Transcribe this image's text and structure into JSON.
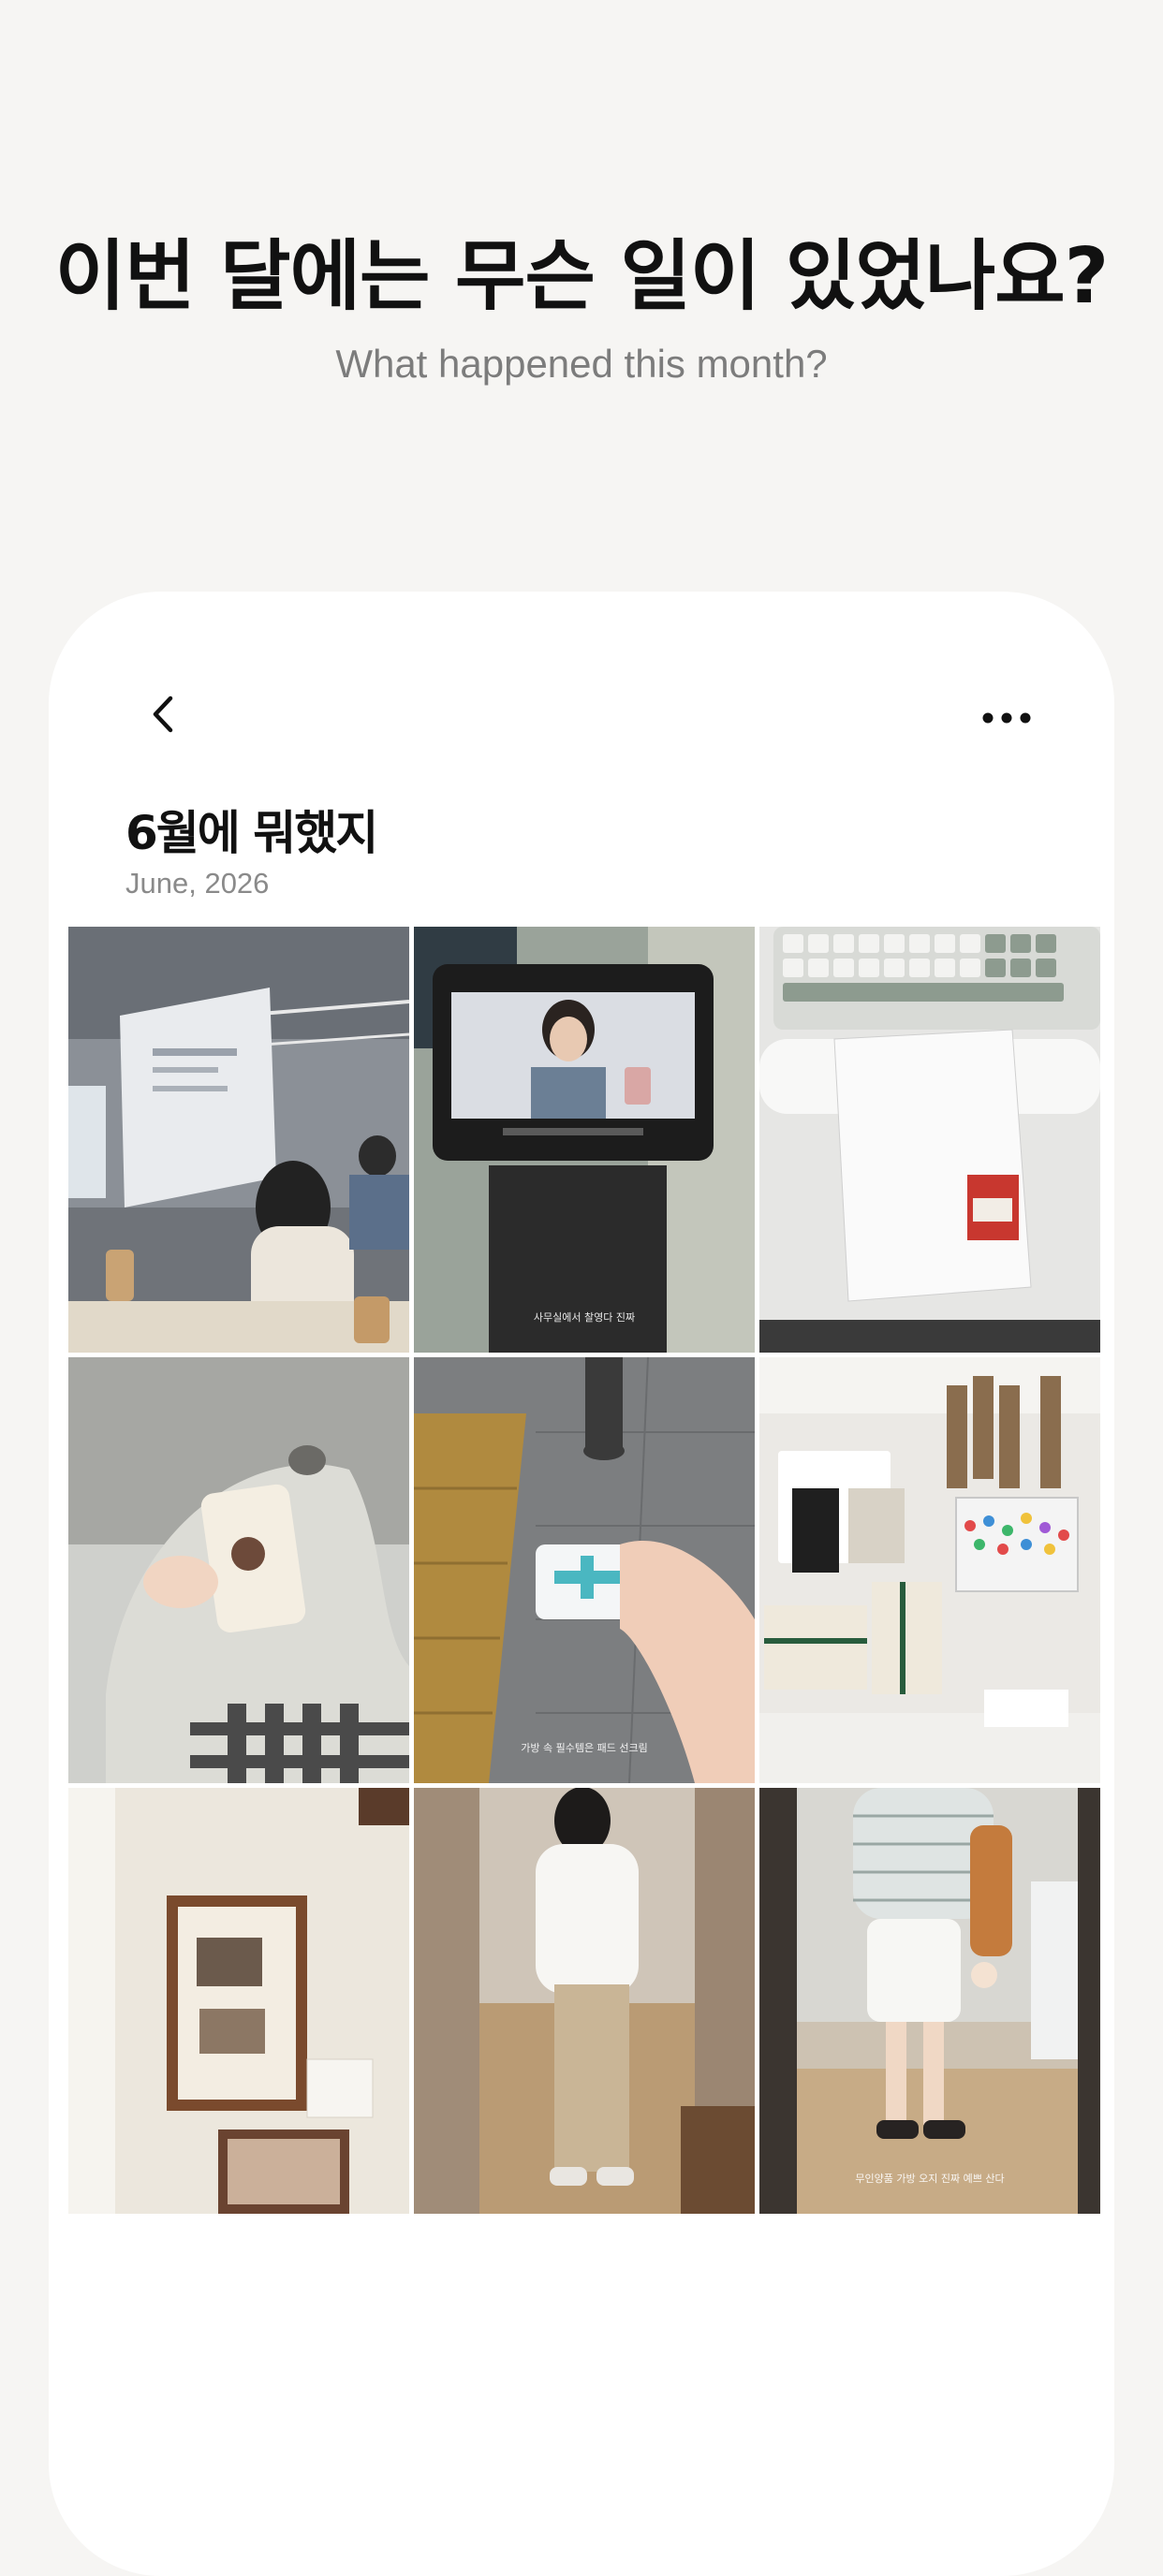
{
  "onboarding": {
    "headline": "이번 달에는 무슨 일이 있었나요?",
    "subheadline": "What happened this month?"
  },
  "toolbar": {
    "back_icon": "chevron-left-icon",
    "more_icon": "more-horizontal-icon"
  },
  "album": {
    "title": "6월에 뭐했지",
    "date": "June, 2026"
  },
  "photos": [
    {
      "scene": "lecture-hall",
      "caption": "",
      "bg": "#8a8f95"
    },
    {
      "scene": "tablet-selfie",
      "caption": "사무실에서 찰영다 진짜",
      "bg": "#8a8f7e"
    },
    {
      "scene": "keyboard-notebook",
      "caption": "",
      "bg": "#e5e5e3"
    },
    {
      "scene": "hand-pouch",
      "caption": "",
      "bg": "#a9a9a6"
    },
    {
      "scene": "hand-sunscreen",
      "caption": "가방 속 필수템은 패드 선크림",
      "bg": "#7b7d7f"
    },
    {
      "scene": "stationery-shelf",
      "caption": "",
      "bg": "#e8e6e2"
    },
    {
      "scene": "framed-pictures",
      "caption": "",
      "bg": "#e7e2d8"
    },
    {
      "scene": "mirror-outfit-1",
      "caption": "",
      "bg": "#b99b75"
    },
    {
      "scene": "mirror-outfit-2",
      "caption": "무인양품 가방 오지 진짜 예쁘 산다",
      "bg": "#cfc4b4"
    }
  ]
}
